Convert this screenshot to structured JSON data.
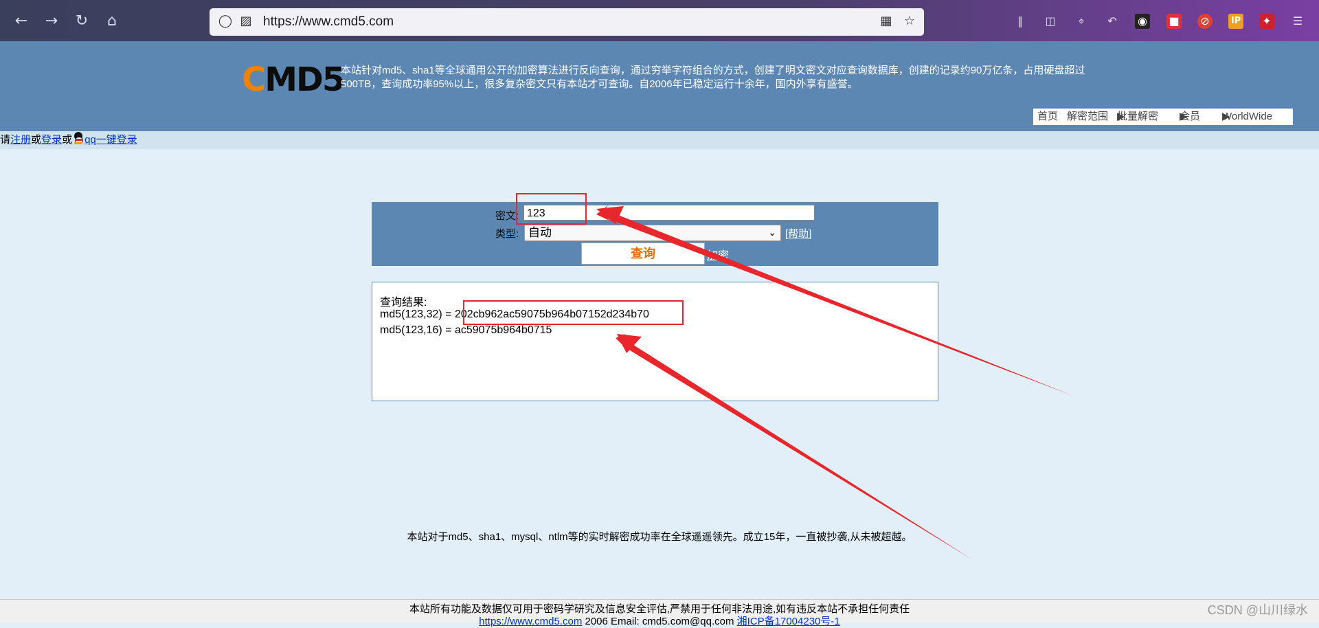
{
  "browser": {
    "url": "https://www.cmd5.com",
    "nav_icons": [
      "back-icon",
      "forward-icon",
      "reload-icon",
      "home-icon"
    ],
    "toolbar_icons": [
      "library-icon",
      "sidebar-icon",
      "crop-icon",
      "undo-icon",
      "extension-icon",
      "extension-icon",
      "extension-icon",
      "ip-icon",
      "extension-icon",
      "menu-icon"
    ],
    "toolbar_ip_label": "IP"
  },
  "site": {
    "logo_c": "C",
    "logo_rest": "MD5",
    "intro": "本站针对md5、sha1等全球通用公开的加密算法进行反向查询，通过穷举字符组合的方式，创建了明文密文对应查询数据库，创建的记录约90万亿条，占用硬盘超过500TB，查询成功率95%以上，很多复杂密文只有本站才可查询。自2006年已稳定运行十余年，国内外享有盛誉。",
    "nav": {
      "home": "首页",
      "scope": "解密范围",
      "batch": "批量解密",
      "member": "会员",
      "worldwide": "WorldWide"
    }
  },
  "login": {
    "prefix": "请",
    "register": "注册",
    "or1": "或",
    "login": "登录",
    "or2": "或",
    "qq_login": "qq一键登录"
  },
  "form": {
    "cipher_label": "密文:",
    "cipher_value": "123",
    "type_label": "类型:",
    "type_value": "自动",
    "help_link": "[帮助]",
    "submit_label": "查询",
    "encrypt_link": "加密"
  },
  "result": {
    "title": "查询结果:",
    "line1_prefix": "md5(123,32) = ",
    "line1_value": "202cb962ac59075b964b07152d234b70",
    "line2": "md5(123,16) = ac59075b964b0715"
  },
  "bottom_note": "本站对于md5、sha1、mysql、ntlm等的实时解密成功率在全球遥遥领先。成立15年，一直被抄袭,从未被超越。",
  "footer": {
    "disclaimer": "本站所有功能及数据仅可用于密码学研究及信息安全评估,严禁用于任何非法用途,如有违反本站不承担任何责任",
    "site_link": "https://www.cmd5.com",
    "mid_text": " 2006   Email: cmd5.com@qq.com ",
    "icp_link": "湘ICP备17004230号-1"
  },
  "watermark": "CSDN @山川绿水",
  "colors": {
    "header_blue": "#5c87b3",
    "page_bg": "#e2eff8",
    "logo_orange": "#f08200",
    "annotation_red": "#e8262b",
    "submit_text": "#f06a00"
  }
}
